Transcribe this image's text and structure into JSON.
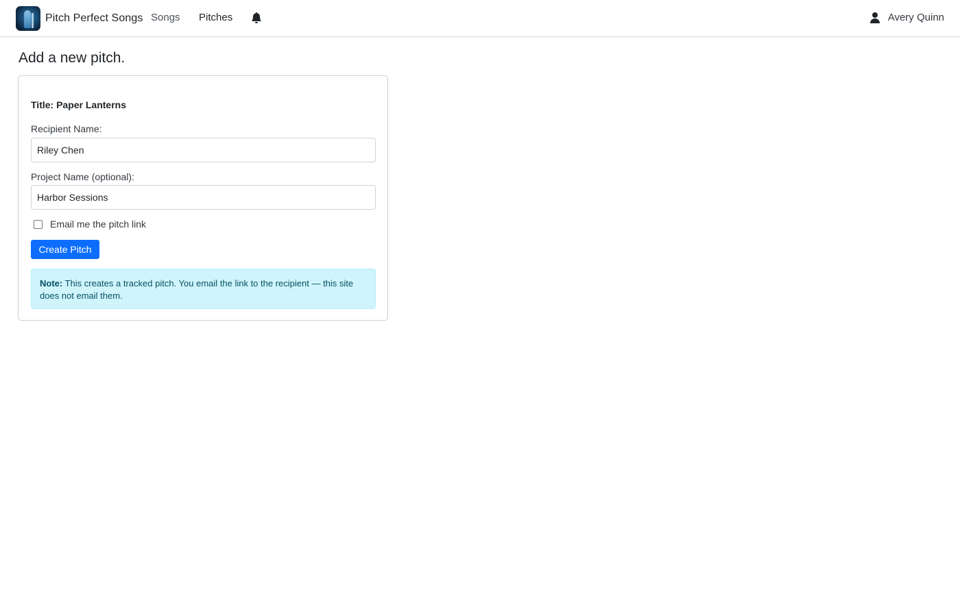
{
  "app": {
    "brand_name": "Pitch Perfect Songs",
    "logo_icon": "band-photo-logo"
  },
  "nav": {
    "songs": "Songs",
    "pitches": "Pitches",
    "notifications_icon": "bell-icon"
  },
  "user": {
    "name": "Avery Quinn",
    "icon": "user-icon"
  },
  "page": {
    "title": "Add a new pitch."
  },
  "form": {
    "song_title": "Title: Paper Lanterns",
    "recipient_label": "Recipient Name:",
    "recipient_value": "Riley Chen",
    "project_label": "Project Name (optional):",
    "project_value": "Harbor Sessions",
    "email_checkbox_label": "Email me the pitch link",
    "email_checkbox_checked": false,
    "submit_label": "Create Pitch"
  },
  "note": {
    "label": "Note:",
    "text": " This creates a tracked pitch. You email the link to the recipient — this site does not email them."
  },
  "colors": {
    "primary": "#0d6efd",
    "note_bg": "#cff4fc",
    "note_text": "#055160"
  }
}
